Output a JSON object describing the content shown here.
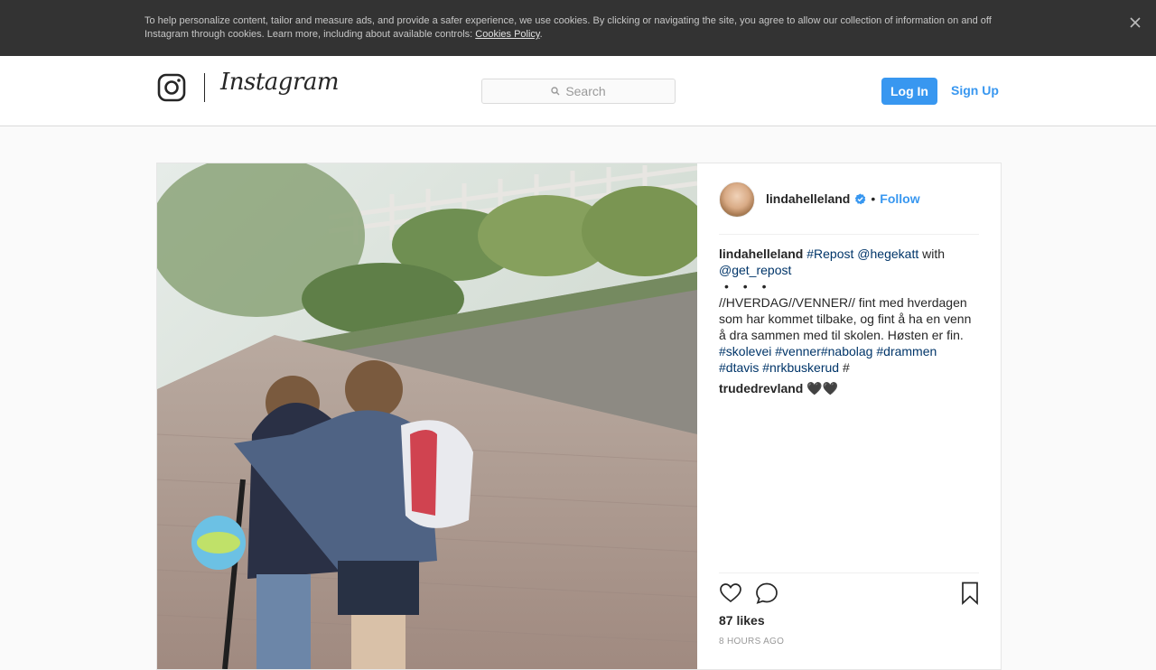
{
  "cookie_banner": {
    "text": "To help personalize content, tailor and measure ads, and provide a safer experience, we use cookies. By clicking or navigating the site, you agree to allow our collection of information on and off Instagram through cookies. Learn more, including about available controls: ",
    "link": "Cookies Policy",
    "end": "."
  },
  "header": {
    "wordmark": "Instagram",
    "search_placeholder": "Search",
    "login_label": "Log In",
    "signup_label": "Sign Up"
  },
  "post": {
    "username": "lindahelleland",
    "separator": "•",
    "follow_label": "Follow",
    "caption": {
      "author": "lindahelleland",
      "tag_repost": "#Repost",
      "mention_1": "@hegekatt",
      "with": "with",
      "mention_2": "@get_repost",
      "dots": "• • •",
      "body": "//HVERDAG//VENNER// fint med hverdagen som har kommet tilbake, og fint å ha en venn å dra sammen med til skolen. Høsten er fin.",
      "tag_1": "#skolevei",
      "tag_2": "#venner",
      "tag_3": "#nabolag",
      "tag_4": "#drammen",
      "tag_5": "#dtavis",
      "tag_6": "#nrkbuskerud",
      "tag_7": "#"
    },
    "comment": {
      "author": "trudedrevland",
      "text": "🖤🖤"
    },
    "likes": "87 likes",
    "time": "8 HOURS AGO"
  }
}
